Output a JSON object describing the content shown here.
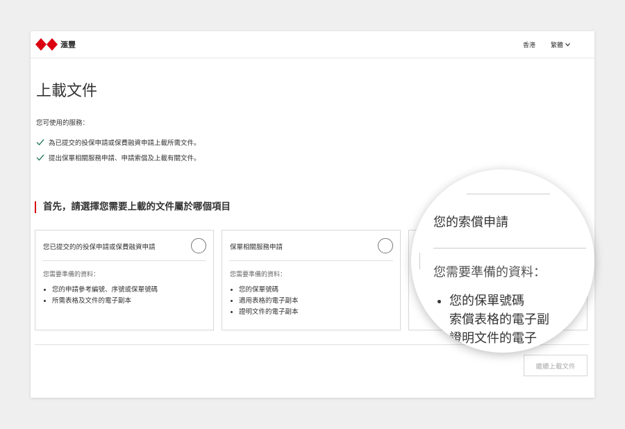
{
  "header": {
    "brand_name": "滙豐",
    "brand_color": "#db0011",
    "region": "香港",
    "language": "繁體",
    "language_icon": "chevron-down-icon"
  },
  "page": {
    "title": "上載文件",
    "intro": "您可使用的服務：",
    "services": [
      "為已提交的投保申請或保費融資申請上載所需文件。",
      "提出保單相關服務申請、申請索償及上載有關文件。"
    ],
    "section_heading": "首先，請選擇您需要上載的文件屬於哪個項目"
  },
  "cards": [
    {
      "title": "您已提交的的投保申請或保費融資申請",
      "sub": "您需要準備的資料：",
      "items": [
        "您的申請參考編號、序號或保單號碼",
        "所需表格及文件的電子副本"
      ]
    },
    {
      "title": "保單相關服務申請",
      "sub": "您需要準備的資料：",
      "items": [
        "您的保單號碼",
        "適用表格的電子副本",
        "證明文件的電子副本"
      ]
    }
  ],
  "continue_button": "繼續上載文件",
  "magnifier": {
    "title": "您的索償申請",
    "sub": "您需要準備的資料：",
    "items": [
      "您的保單號碼",
      "索償表格的電子副",
      "證明文件的電子"
    ]
  }
}
